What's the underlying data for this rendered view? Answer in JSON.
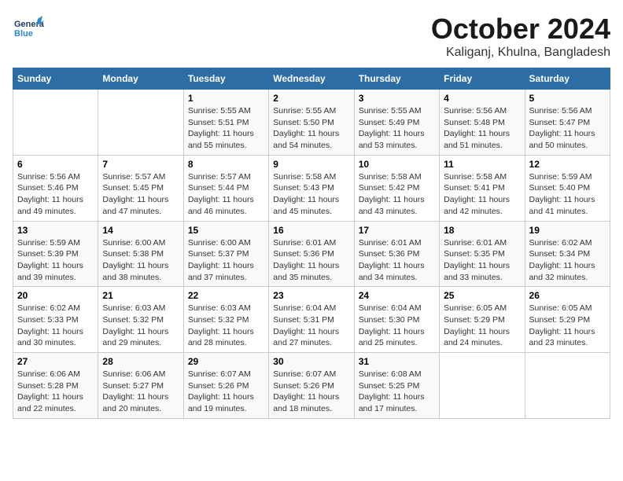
{
  "header": {
    "logo_general": "General",
    "logo_blue": "Blue",
    "month": "October 2024",
    "location": "Kaliganj, Khulna, Bangladesh"
  },
  "days_of_week": [
    "Sunday",
    "Monday",
    "Tuesday",
    "Wednesday",
    "Thursday",
    "Friday",
    "Saturday"
  ],
  "weeks": [
    [
      {
        "day": "",
        "info": ""
      },
      {
        "day": "",
        "info": ""
      },
      {
        "day": "1",
        "info": "Sunrise: 5:55 AM\nSunset: 5:51 PM\nDaylight: 11 hours and 55 minutes."
      },
      {
        "day": "2",
        "info": "Sunrise: 5:55 AM\nSunset: 5:50 PM\nDaylight: 11 hours and 54 minutes."
      },
      {
        "day": "3",
        "info": "Sunrise: 5:55 AM\nSunset: 5:49 PM\nDaylight: 11 hours and 53 minutes."
      },
      {
        "day": "4",
        "info": "Sunrise: 5:56 AM\nSunset: 5:48 PM\nDaylight: 11 hours and 51 minutes."
      },
      {
        "day": "5",
        "info": "Sunrise: 5:56 AM\nSunset: 5:47 PM\nDaylight: 11 hours and 50 minutes."
      }
    ],
    [
      {
        "day": "6",
        "info": "Sunrise: 5:56 AM\nSunset: 5:46 PM\nDaylight: 11 hours and 49 minutes."
      },
      {
        "day": "7",
        "info": "Sunrise: 5:57 AM\nSunset: 5:45 PM\nDaylight: 11 hours and 47 minutes."
      },
      {
        "day": "8",
        "info": "Sunrise: 5:57 AM\nSunset: 5:44 PM\nDaylight: 11 hours and 46 minutes."
      },
      {
        "day": "9",
        "info": "Sunrise: 5:58 AM\nSunset: 5:43 PM\nDaylight: 11 hours and 45 minutes."
      },
      {
        "day": "10",
        "info": "Sunrise: 5:58 AM\nSunset: 5:42 PM\nDaylight: 11 hours and 43 minutes."
      },
      {
        "day": "11",
        "info": "Sunrise: 5:58 AM\nSunset: 5:41 PM\nDaylight: 11 hours and 42 minutes."
      },
      {
        "day": "12",
        "info": "Sunrise: 5:59 AM\nSunset: 5:40 PM\nDaylight: 11 hours and 41 minutes."
      }
    ],
    [
      {
        "day": "13",
        "info": "Sunrise: 5:59 AM\nSunset: 5:39 PM\nDaylight: 11 hours and 39 minutes."
      },
      {
        "day": "14",
        "info": "Sunrise: 6:00 AM\nSunset: 5:38 PM\nDaylight: 11 hours and 38 minutes."
      },
      {
        "day": "15",
        "info": "Sunrise: 6:00 AM\nSunset: 5:37 PM\nDaylight: 11 hours and 37 minutes."
      },
      {
        "day": "16",
        "info": "Sunrise: 6:01 AM\nSunset: 5:36 PM\nDaylight: 11 hours and 35 minutes."
      },
      {
        "day": "17",
        "info": "Sunrise: 6:01 AM\nSunset: 5:36 PM\nDaylight: 11 hours and 34 minutes."
      },
      {
        "day": "18",
        "info": "Sunrise: 6:01 AM\nSunset: 5:35 PM\nDaylight: 11 hours and 33 minutes."
      },
      {
        "day": "19",
        "info": "Sunrise: 6:02 AM\nSunset: 5:34 PM\nDaylight: 11 hours and 32 minutes."
      }
    ],
    [
      {
        "day": "20",
        "info": "Sunrise: 6:02 AM\nSunset: 5:33 PM\nDaylight: 11 hours and 30 minutes."
      },
      {
        "day": "21",
        "info": "Sunrise: 6:03 AM\nSunset: 5:32 PM\nDaylight: 11 hours and 29 minutes."
      },
      {
        "day": "22",
        "info": "Sunrise: 6:03 AM\nSunset: 5:32 PM\nDaylight: 11 hours and 28 minutes."
      },
      {
        "day": "23",
        "info": "Sunrise: 6:04 AM\nSunset: 5:31 PM\nDaylight: 11 hours and 27 minutes."
      },
      {
        "day": "24",
        "info": "Sunrise: 6:04 AM\nSunset: 5:30 PM\nDaylight: 11 hours and 25 minutes."
      },
      {
        "day": "25",
        "info": "Sunrise: 6:05 AM\nSunset: 5:29 PM\nDaylight: 11 hours and 24 minutes."
      },
      {
        "day": "26",
        "info": "Sunrise: 6:05 AM\nSunset: 5:29 PM\nDaylight: 11 hours and 23 minutes."
      }
    ],
    [
      {
        "day": "27",
        "info": "Sunrise: 6:06 AM\nSunset: 5:28 PM\nDaylight: 11 hours and 22 minutes."
      },
      {
        "day": "28",
        "info": "Sunrise: 6:06 AM\nSunset: 5:27 PM\nDaylight: 11 hours and 20 minutes."
      },
      {
        "day": "29",
        "info": "Sunrise: 6:07 AM\nSunset: 5:26 PM\nDaylight: 11 hours and 19 minutes."
      },
      {
        "day": "30",
        "info": "Sunrise: 6:07 AM\nSunset: 5:26 PM\nDaylight: 11 hours and 18 minutes."
      },
      {
        "day": "31",
        "info": "Sunrise: 6:08 AM\nSunset: 5:25 PM\nDaylight: 11 hours and 17 minutes."
      },
      {
        "day": "",
        "info": ""
      },
      {
        "day": "",
        "info": ""
      }
    ]
  ]
}
